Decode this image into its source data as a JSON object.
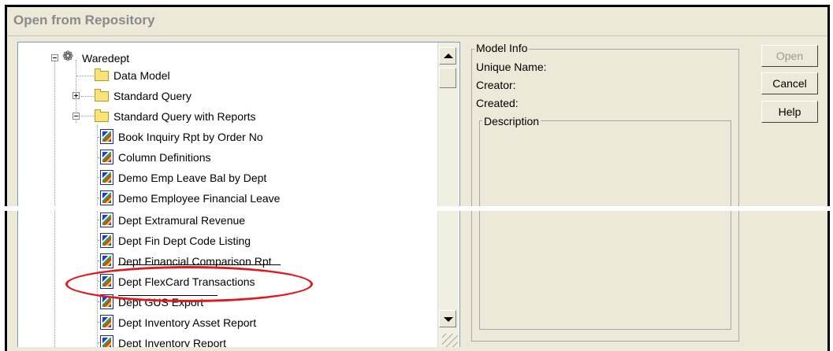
{
  "window": {
    "title": "Open from Repository"
  },
  "tree": {
    "root": {
      "label": "Waredept",
      "icon": "model-repository-icon"
    },
    "folders": [
      {
        "label": "Data Model",
        "expander": "none"
      },
      {
        "label": "Standard Query",
        "expander": "plus"
      },
      {
        "label": "Standard Query with Reports",
        "expander": "minus"
      }
    ],
    "reports": [
      "Book Inquiry Rpt by Order No",
      "Column Definitions",
      "Demo Emp Leave Bal by Dept",
      "Demo Employee Financial Leave",
      "Dept Extramural Revenue",
      "Dept Fin Dept Code Listing",
      "Dept Financial Comparison Rpt",
      "Dept FlexCard Transactions",
      "Dept GUS Export",
      "Dept Inventory Asset Report",
      "Dept Inventory Report"
    ],
    "highlighted_item": "Dept FlexCard Transactions"
  },
  "model_info": {
    "legend": "Model Info",
    "unique_name_label": "Unique Name:",
    "creator_label": "Creator:",
    "created_label": "Created:",
    "description_legend": "Description"
  },
  "buttons": {
    "open": "Open",
    "cancel": "Cancel",
    "help": "Help"
  },
  "colors": {
    "annotation": "#e0191f",
    "dialog_bg": "#ece9d8"
  }
}
